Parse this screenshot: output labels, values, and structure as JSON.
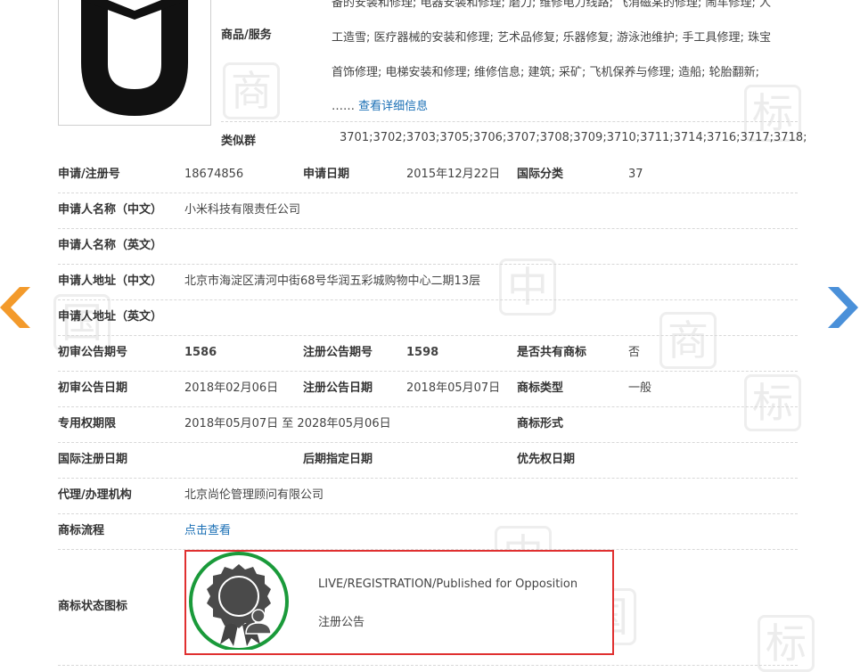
{
  "goods": {
    "label": "商品/服务",
    "lines": [
      "备的安装和修理; 电器安装和修理; 磨刀; 维修电力线路; 飞消磁某的修理; 闹车修理; 人",
      "工造雪; 医疗器械的安装和修理; 艺术品修复; 乐器修复; 游泳池维护; 手工具修理; 珠宝",
      "首饰修理; 电梯安装和修理; 维修信息; 建筑; 采矿; 飞机保养与修理; 造船; 轮胎翻新;"
    ],
    "ellipsis": "……",
    "more_link": "查看详细信息"
  },
  "similar_group": {
    "label": "类似群",
    "value": "3701;3702;3703;3705;3706;3707;3708;3709;3710;3711;3714;3716;3717;3718;"
  },
  "rows": {
    "reg_no": {
      "label": "申请/注册号",
      "value": "18674856"
    },
    "apply_date": {
      "label": "申请日期",
      "value": "2015年12月22日"
    },
    "intl_class": {
      "label": "国际分类",
      "value": "37"
    },
    "applicant_cn": {
      "label": "申请人名称（中文）",
      "value": "小米科技有限责任公司"
    },
    "applicant_en": {
      "label": "申请人名称（英文）",
      "value": ""
    },
    "address_cn": {
      "label": "申请人地址（中文）",
      "value": "北京市海淀区清河中街68号华润五彩城购物中心二期13层"
    },
    "address_en": {
      "label": "申请人地址（英文）",
      "value": ""
    },
    "prelim_issue": {
      "label": "初审公告期号",
      "value": "1586"
    },
    "reg_issue": {
      "label": "注册公告期号",
      "value": "1598"
    },
    "shared": {
      "label": "是否共有商标",
      "value": "否"
    },
    "prelim_date": {
      "label": "初审公告日期",
      "value": "2018年02月06日"
    },
    "reg_date": {
      "label": "注册公告日期",
      "value": "2018年05月07日"
    },
    "tm_type": {
      "label": "商标类型",
      "value": "一般"
    },
    "exclusive": {
      "label": "专用权期限",
      "value": "2018年05月07日 至 2028年05月06日"
    },
    "tm_form": {
      "label": "商标形式",
      "value": ""
    },
    "intl_reg_date": {
      "label": "国际注册日期",
      "value": ""
    },
    "later_date": {
      "label": "后期指定日期",
      "value": ""
    },
    "priority_date": {
      "label": "优先权日期",
      "value": ""
    },
    "agent": {
      "label": "代理/办理机构",
      "value": "北京尚伦管理顾问有限公司"
    },
    "flow": {
      "label": "商标流程",
      "value": "点击查看"
    },
    "status_icon": {
      "label": "商标状态图标"
    }
  },
  "status": {
    "english": "LIVE/REGISTRATION/Published for Opposition",
    "chinese": "注册公告"
  },
  "watermark": {
    "chars": [
      "中",
      "国",
      "商",
      "标"
    ]
  },
  "colors": {
    "link": "#1a6fb5",
    "prev_arrow": "#f39a2b",
    "next_arrow": "#4a90d9",
    "status_ring": "#1a9a3a",
    "highlight_border": "#e03030"
  }
}
